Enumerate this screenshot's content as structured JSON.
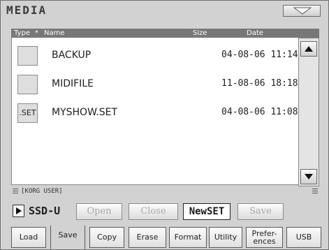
{
  "window": {
    "title": "MEDIA",
    "menu_icon": "menu-arrow-icon"
  },
  "columns": {
    "type": "Type",
    "sort_marker": "*",
    "name": "Name",
    "size": "Size",
    "date": "Date"
  },
  "files": [
    {
      "icon": "folder-icon",
      "icon_label": "",
      "name": "BACKUP",
      "date": "04-08-06 11:14"
    },
    {
      "icon": "folder-icon",
      "icon_label": "",
      "name": "MIDIFILE",
      "date": "11-08-06 18:18"
    },
    {
      "icon": "set-file-icon",
      "icon_label": ".SET",
      "name": "MYSHOW.SET",
      "date": "04-08-06 11:08"
    }
  ],
  "path": "[KORG USER]",
  "device": {
    "label": "SSD-U"
  },
  "actions": {
    "open": "Open",
    "close": "Close",
    "new_set": "NewSET",
    "save": "Save"
  },
  "tabs": [
    {
      "label": "Load"
    },
    {
      "label": "Save",
      "active": true
    },
    {
      "label": "Copy"
    },
    {
      "label": "Erase"
    },
    {
      "label": "Format"
    },
    {
      "label": "Utility"
    },
    {
      "label": "Prefer-\nences"
    },
    {
      "label": "USB"
    }
  ]
}
